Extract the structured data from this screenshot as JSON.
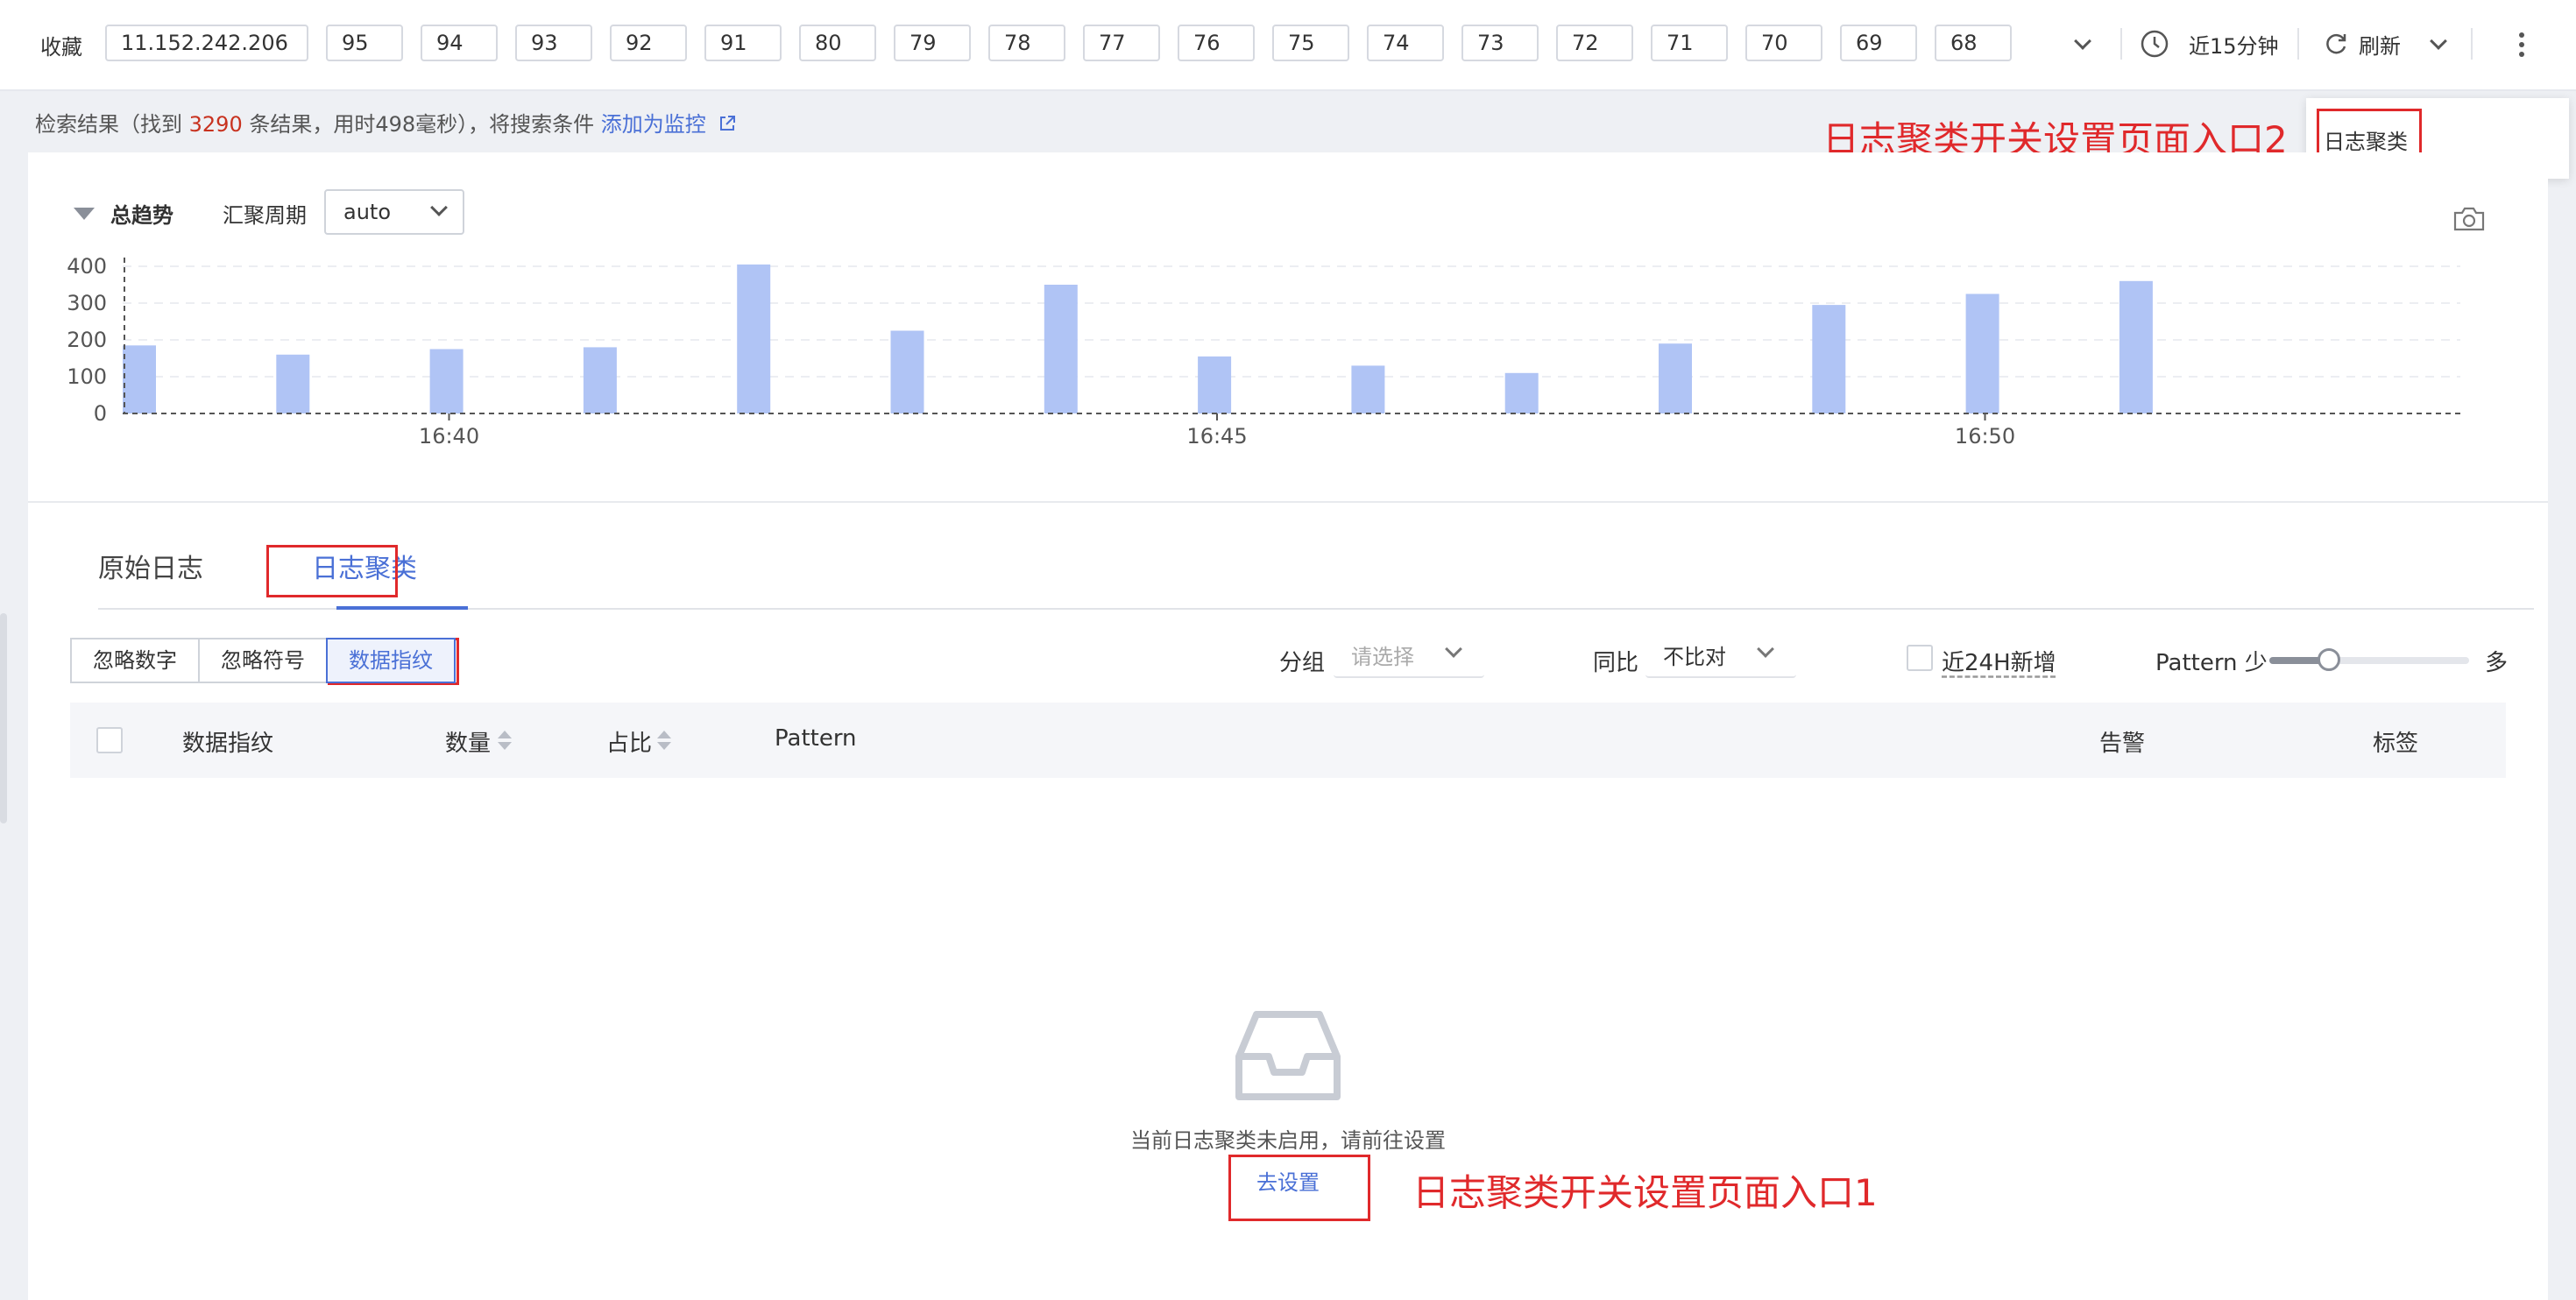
{
  "toolbar": {
    "favorites_label": "收藏",
    "chips": [
      "11.152.242.206",
      "95",
      "94",
      "93",
      "92",
      "91",
      "80",
      "79",
      "78",
      "77",
      "76",
      "75",
      "74",
      "73",
      "72",
      "71",
      "70",
      "69",
      "68"
    ],
    "time_range": "近15分钟",
    "refresh_label": "刷新"
  },
  "result": {
    "prefix": "检索结果（找到 ",
    "count": "3290",
    "suffix": " 条结果，用时498毫秒），将搜索条件",
    "monitor_link": "添加为监控"
  },
  "dropdown": {
    "item": "日志聚类"
  },
  "annotations": {
    "entry2": "日志聚类开关设置页面入口2",
    "entry1": "日志聚类开关设置页面入口1"
  },
  "trend": {
    "title": "总趋势",
    "agg_label": "汇聚周期",
    "agg_value": "auto"
  },
  "chart_data": {
    "type": "bar",
    "title": "",
    "xlabel": "",
    "ylabel": "",
    "ylim": [
      0,
      400
    ],
    "yticks": [
      0,
      100,
      200,
      300,
      400
    ],
    "x_tick_labels": [
      "16:40",
      "16:45",
      "16:50"
    ],
    "x_tick_minutes": [
      2.125,
      7.125,
      12.125
    ],
    "bar_minutes": [
      0,
      1,
      2,
      3,
      4,
      5,
      6,
      7,
      8,
      9,
      10,
      11,
      12,
      13
    ],
    "values": [
      185,
      160,
      175,
      180,
      405,
      225,
      350,
      155,
      130,
      110,
      190,
      295,
      325,
      360
    ],
    "bar_color": "#b0c4f5",
    "grid": true
  },
  "tabs": {
    "raw": "原始日志",
    "cluster": "日志聚类"
  },
  "options": {
    "ignore_numbers": "忽略数字",
    "ignore_symbols": "忽略符号",
    "data_fingerprint": "数据指纹"
  },
  "filters": {
    "group_label": "分组",
    "group_placeholder": "请选择",
    "compare_label": "同比",
    "compare_value": "不比对",
    "new24h_label": "近24H新增",
    "pattern_label": "Pattern 少",
    "pattern_more": "多",
    "pattern_level": 0.3
  },
  "table": {
    "headers": {
      "fingerprint": "数据指纹",
      "count": "数量",
      "ratio": "占比",
      "pattern": "Pattern",
      "alarm": "告警",
      "tags": "标签"
    }
  },
  "empty": {
    "message": "当前日志聚类未启用，请前往设置",
    "goto_link": "去设置"
  },
  "colors": {
    "accent": "#4a70d6",
    "annotation": "#e0292b",
    "count_highlight": "#c8321f"
  }
}
